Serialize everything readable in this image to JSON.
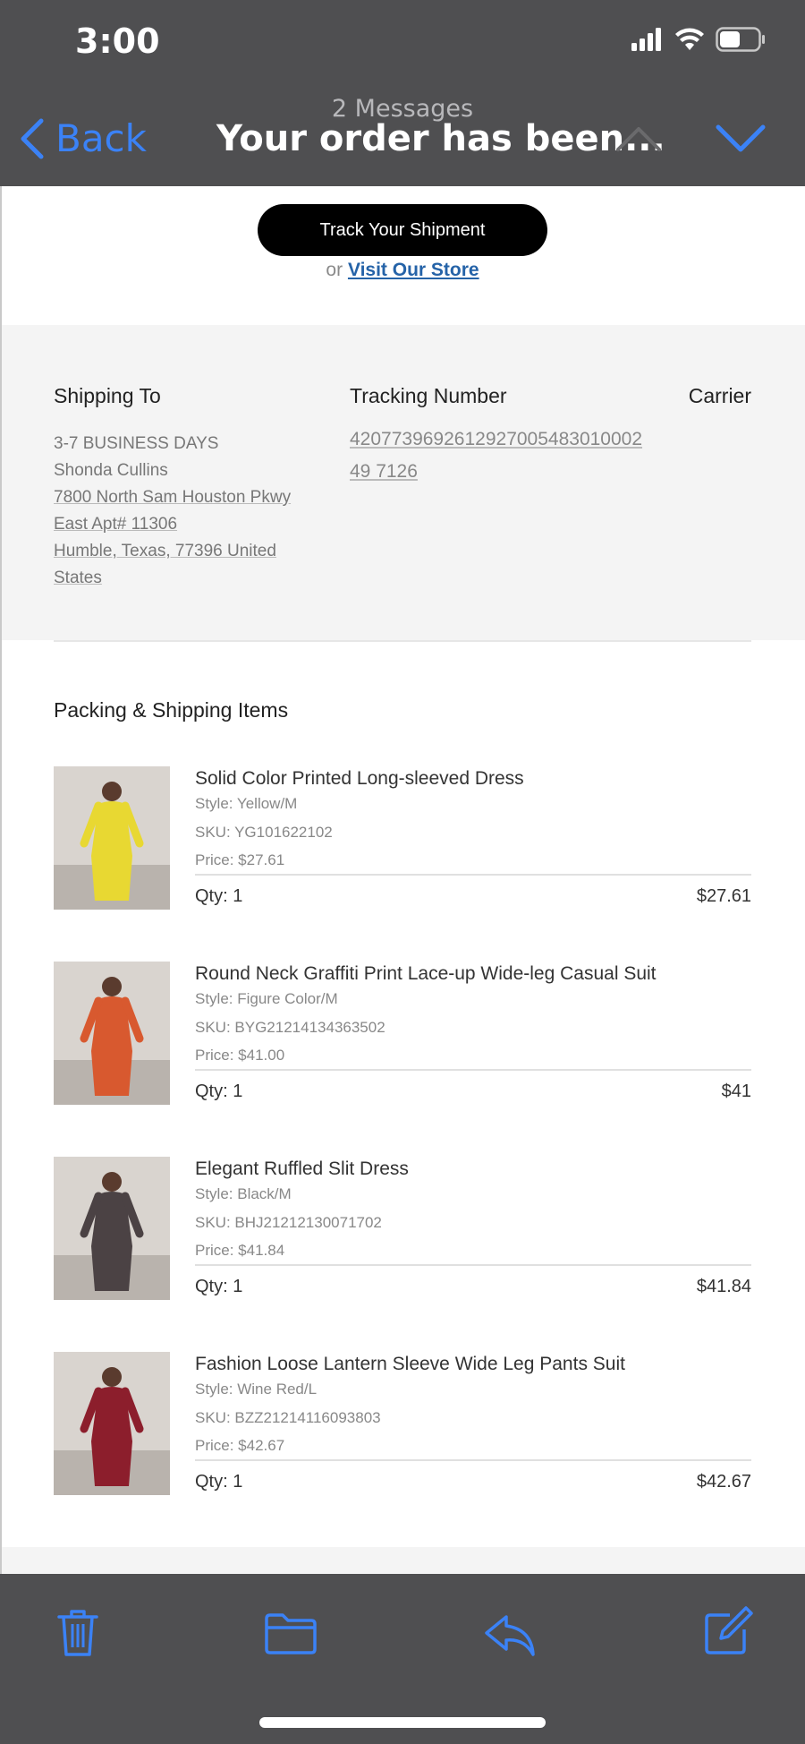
{
  "status": {
    "time": "3:00"
  },
  "nav": {
    "back_label": "Back",
    "subtitle": "2 Messages",
    "title": "Your order has been..."
  },
  "email": {
    "track_button": "Track Your Shipment",
    "or_text": "or",
    "visit_store": "Visit Our Store",
    "shipping": {
      "shipping_to_label": "Shipping To",
      "tracking_label": "Tracking Number",
      "carrier_label": "Carrier",
      "service": "3-7 BUSINESS DAYS",
      "name": "Shonda Cullins",
      "address_line1": "7800 North Sam Houston Pkwy",
      "address_line2": "East Apt# 11306",
      "address_line3": "Humble, Texas, 77396 United",
      "address_line4": "States",
      "tracking_number": "420773969261292700548301000249 7126"
    },
    "items_title": "Packing & Shipping Items",
    "items": [
      {
        "name": "Solid Color Printed Long-sleeved Dress",
        "style": "Style: Yellow/M",
        "sku": "SKU: YG101622102",
        "price": "Price: $27.61",
        "qty": "Qty: 1",
        "total": "$27.61",
        "img_color": "#e8d832"
      },
      {
        "name": "Round Neck Graffiti Print Lace-up Wide-leg Casual Suit",
        "style": "Style: Figure Color/M",
        "sku": "SKU: BYG21214134363502",
        "price": "Price: $41.00",
        "qty": "Qty: 1",
        "total": "$41",
        "img_color": "#d8592f"
      },
      {
        "name": "Elegant Ruffled Slit Dress",
        "style": "Style: Black/M",
        "sku": "SKU: BHJ21212130071702",
        "price": "Price: $41.84",
        "qty": "Qty: 1",
        "total": "$41.84",
        "img_color": "#4b4244"
      },
      {
        "name": "Fashion Loose Lantern Sleeve Wide Leg Pants Suit",
        "style": "Style: Wine Red/L",
        "sku": "SKU: BZZ21214116093803",
        "price": "Price: $42.67",
        "qty": "Qty: 1",
        "total": "$42.67",
        "img_color": "#8c1e2c"
      }
    ]
  },
  "toolbar": {
    "icons": [
      "trash-icon",
      "folder-icon",
      "reply-icon",
      "compose-icon"
    ]
  },
  "colors": {
    "accent": "#3b82f6",
    "bar_bg": "#4f4f51"
  }
}
